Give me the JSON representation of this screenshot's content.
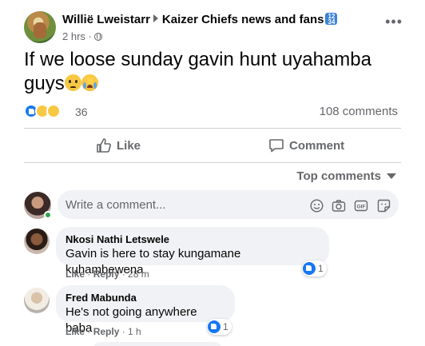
{
  "post": {
    "author": "Willië Lweistarr",
    "group": "Kaizer Chiefs news and fans",
    "group_badge": "🔢",
    "time": "2 hrs ·",
    "privacy_icon": "globe-icon",
    "text": "If we loose sunday gavin hunt uyahamba guys",
    "emojis": [
      "pleading-face",
      "loudly-crying-face"
    ],
    "reaction_types": [
      "like",
      "sad",
      "haha"
    ],
    "reaction_count": "36",
    "comment_count": "108 comments"
  },
  "actions": {
    "like_label": "Like",
    "comment_label": "Comment"
  },
  "sort": {
    "label": "Top comments"
  },
  "composer": {
    "placeholder": "Write a comment...",
    "icons": [
      "emoji-icon",
      "camera-icon",
      "gif-icon",
      "sticker-icon"
    ]
  },
  "comments": [
    {
      "name": "Nkosi Nathi Letswele",
      "text": "Gavin is here to stay kungamane kuhambewena",
      "like": "Like",
      "reply": "Reply",
      "time": "28 m",
      "reactions": "1"
    },
    {
      "name": "Fred Mabunda",
      "text": "He's not going anywhere baba",
      "like": "Like",
      "reply": "Reply",
      "time": "1 h",
      "reactions": "1"
    }
  ],
  "colors": {
    "accent": "#1877f2",
    "secondary_text": "#65676b",
    "bubble": "#f0f2f5",
    "online": "#31a24c"
  }
}
